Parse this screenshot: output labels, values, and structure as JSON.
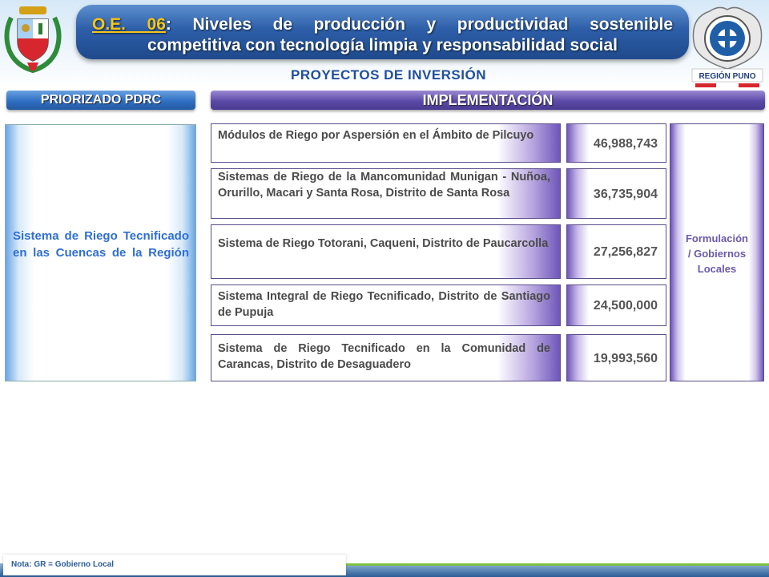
{
  "header": {
    "code": "O.E. 06",
    "title_line1": "Niveles de producción y productividad sostenible",
    "title_line2": "competitiva con tecnología limpia y responsabilidad social",
    "right_logo_label": "REGIÓN PUNO"
  },
  "section_title": "PROYECTOS DE INVERSIÓN",
  "tabs": {
    "prioritized": "PRIORIZADO PDRC",
    "implementation": "IMPLEMENTACIÓN"
  },
  "left_box": {
    "text": "Sistema de Riego Tecnificado en las Cuencas de la Región"
  },
  "projects": [
    {
      "name": "Módulos de Riego por Aspersión en el Ámbito de Pilcuyo",
      "amount": "46,988,743"
    },
    {
      "name": "Sistemas de Riego de la Mancomunidad Munigan - Nuñoa, Orurillo, Macari y Santa Rosa, Distrito de Santa Rosa",
      "amount": "36,735,904"
    },
    {
      "name": "Sistema de Riego Totorani, Caqueni, Distrito de Paucarcolla",
      "amount": "27,256,827"
    },
    {
      "name": "Sistema Integral de Riego Tecnificado, Distrito de Santiago de Pupuja",
      "amount": "24,500,000"
    },
    {
      "name": "Sistema de Riego Tecnificado en la Comunidad de Carancas, Distrito de Desaguadero",
      "amount": "19,993,560"
    }
  ],
  "right_box": {
    "line1": "Formulación",
    "line2": "/ Gobiernos",
    "line3": "Locales"
  },
  "footer": {
    "note": "Nota: GR = Gobierno Local"
  }
}
